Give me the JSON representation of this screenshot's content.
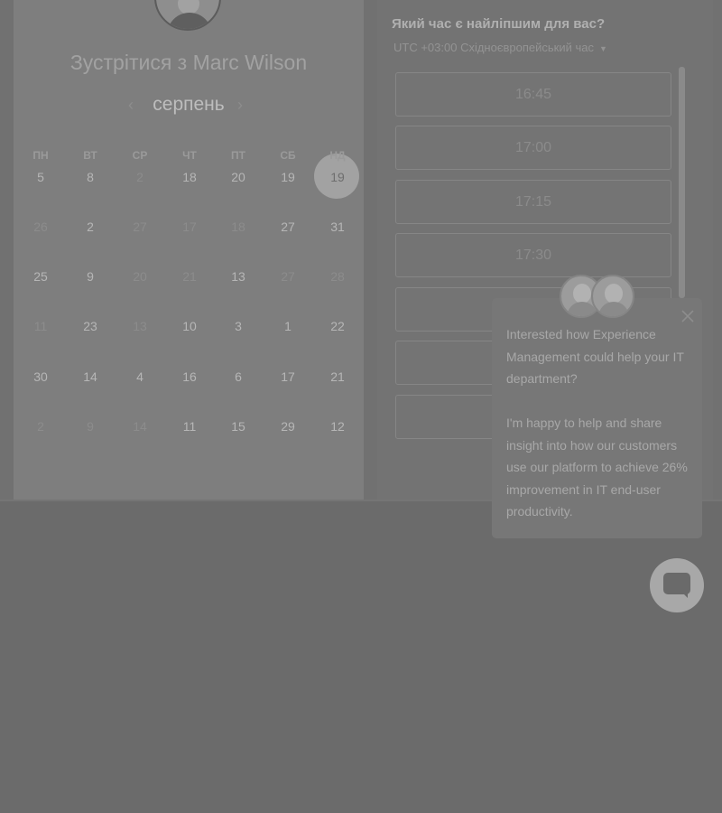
{
  "scheduler": {
    "title": "Зустрітися з Marc Wilson",
    "month": "серпень",
    "weekdays": [
      "ПН",
      "ВТ",
      "СР",
      "ЧТ",
      "ПТ",
      "СБ",
      "НД"
    ],
    "weeks": [
      [
        "5",
        "8",
        "2",
        "18",
        "20",
        "19",
        "19"
      ],
      [
        "26",
        "2",
        "27",
        "17",
        "18",
        "27",
        "31"
      ],
      [
        "25",
        "9",
        "20",
        "21",
        "13",
        "27",
        "28"
      ],
      [
        "11",
        "23",
        "13",
        "10",
        "3",
        "1",
        "22"
      ],
      [
        "30",
        "14",
        "4",
        "16",
        "6",
        "17",
        "21"
      ],
      [
        "2",
        "9",
        "14",
        "11",
        "15",
        "29",
        "12"
      ]
    ],
    "selected_day": "19"
  },
  "times": {
    "question": "Який час є найліпшим для вас?",
    "timezone": "UTC +03:00 Східноєвропейський час",
    "slots": [
      "16:45",
      "17:00",
      "17:15",
      "17:30",
      "",
      "",
      ""
    ]
  },
  "chat": {
    "message_1": "Interested how Experience Management could help your IT department?",
    "message_2": "I'm happy to help and share insight into how our customers use our platform to achieve 26% improvement in IT end-user productivity."
  }
}
